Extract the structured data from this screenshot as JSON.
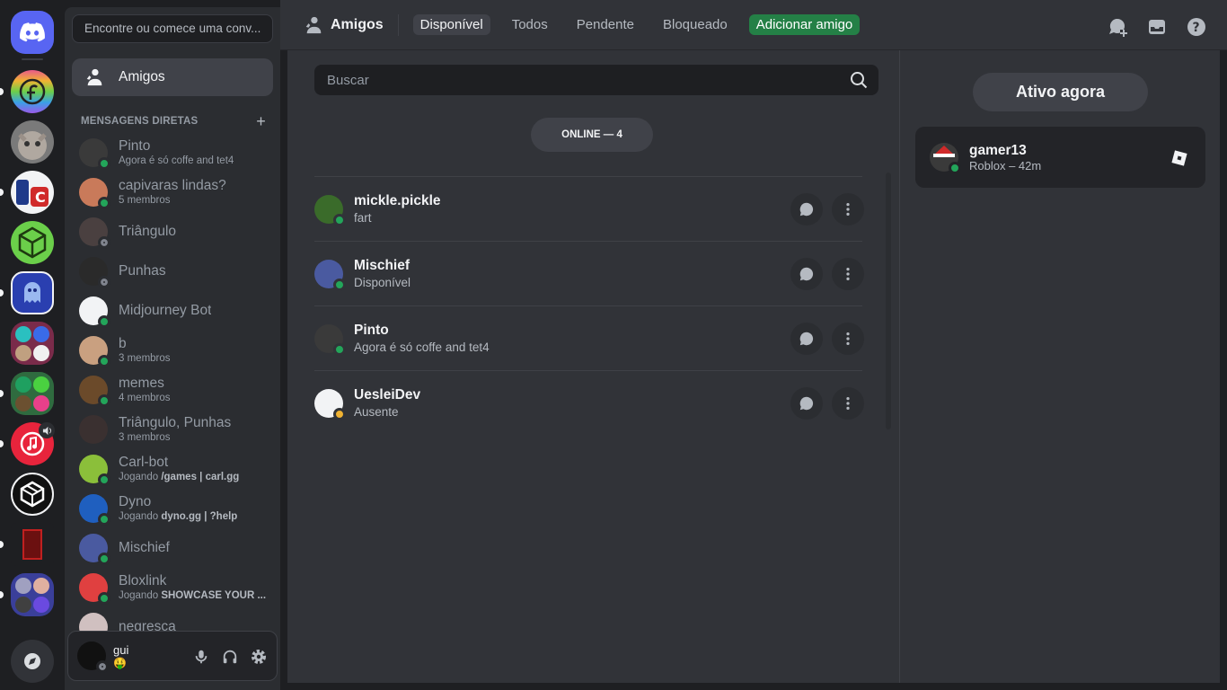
{
  "servers": [
    {
      "name": "discord-home",
      "color": "#5865f2"
    },
    {
      "name": "server-fedora",
      "color": "#e85a8a"
    },
    {
      "name": "server-cat",
      "color": "#8a8a8a"
    },
    {
      "name": "server-uc",
      "color": "#1f3a8a"
    },
    {
      "name": "server-green-cube",
      "color": "#6bcf4a"
    },
    {
      "name": "server-ghost",
      "color": "#2a3fb0"
    },
    {
      "name": "folder-1",
      "color": "#7a2b4a"
    },
    {
      "name": "folder-2",
      "color": "#2f6b3f"
    },
    {
      "name": "server-music",
      "color": "#e8243c"
    },
    {
      "name": "server-cubes",
      "color": "#111111"
    },
    {
      "name": "server-red-art",
      "color": "#6b1010"
    },
    {
      "name": "folder-3",
      "color": "#3a3f9a"
    }
  ],
  "sidebar": {
    "search_placeholder": "Encontre ou comece uma conv...",
    "friends_label": "Amigos",
    "dm_header": "MENSAGENS DIRETAS",
    "dm_add": "+",
    "dms": [
      {
        "name": "Pinto",
        "sub": "Agora é só coffe and tet4",
        "status": "on",
        "color": "#3a3a3a"
      },
      {
        "name": "capivaras lindas?",
        "sub": "5 membros",
        "status": "on",
        "color": "#c97a5a"
      },
      {
        "name": "Triângulo",
        "sub": "",
        "status": "off",
        "color": "#4a4040"
      },
      {
        "name": "Punhas",
        "sub": "",
        "status": "off",
        "color": "#2a2a2a"
      },
      {
        "name": "Midjourney Bot",
        "sub": "",
        "status": "on",
        "color": "#f2f3f5"
      },
      {
        "name": "b",
        "sub": "3 membros",
        "status": "on",
        "color": "#c9a080"
      },
      {
        "name": "memes",
        "sub": "4 membros",
        "status": "on",
        "color": "#6b4a2a"
      },
      {
        "name": "Triângulo, Punhas",
        "sub": "3 membros",
        "status": "",
        "color": "#3a3030"
      },
      {
        "name": "Carl-bot",
        "sub_prefix": "Jogando ",
        "sub_bold": "/games | carl.gg",
        "status": "on",
        "color": "#8bbf3a"
      },
      {
        "name": "Dyno",
        "sub_prefix": "Jogando ",
        "sub_bold": "dyno.gg | ?help",
        "status": "on",
        "color": "#1f5fbf"
      },
      {
        "name": "Mischief",
        "sub": "",
        "status": "on",
        "color": "#4a5aa0"
      },
      {
        "name": "Bloxlink",
        "sub_prefix": "Jogando ",
        "sub_bold": "SHOWCASE YOUR ...",
        "status": "on",
        "color": "#e04040"
      },
      {
        "name": "negresca",
        "sub": "",
        "status": "",
        "color": "#d0c0c0"
      }
    ],
    "user": {
      "name": "gui",
      "status_emoji": "🤑"
    }
  },
  "topbar": {
    "title": "Amigos",
    "tabs": [
      "Disponível",
      "Todos",
      "Pendente",
      "Bloqueado"
    ],
    "add_friend": "Adicionar amigo"
  },
  "main": {
    "search_placeholder": "Buscar",
    "online_label": "ONLINE — 4",
    "friends": [
      {
        "name": "mickle.pickle",
        "sub": "fart",
        "status": "on",
        "color": "#3a6b2a"
      },
      {
        "name": "Mischief",
        "sub": "Disponível",
        "status": "on",
        "color": "#4a5aa0"
      },
      {
        "name": "Pinto",
        "sub": "Agora é só coffe and tet4",
        "status": "on",
        "color": "#3a3a3a"
      },
      {
        "name": "UesleiDev",
        "sub": "Ausente",
        "status": "idle",
        "color": "#f2f3f5"
      }
    ]
  },
  "side": {
    "active_now": "Ativo agora",
    "activity": {
      "name": "gamer13",
      "sub": "Roblox – 42m"
    }
  }
}
